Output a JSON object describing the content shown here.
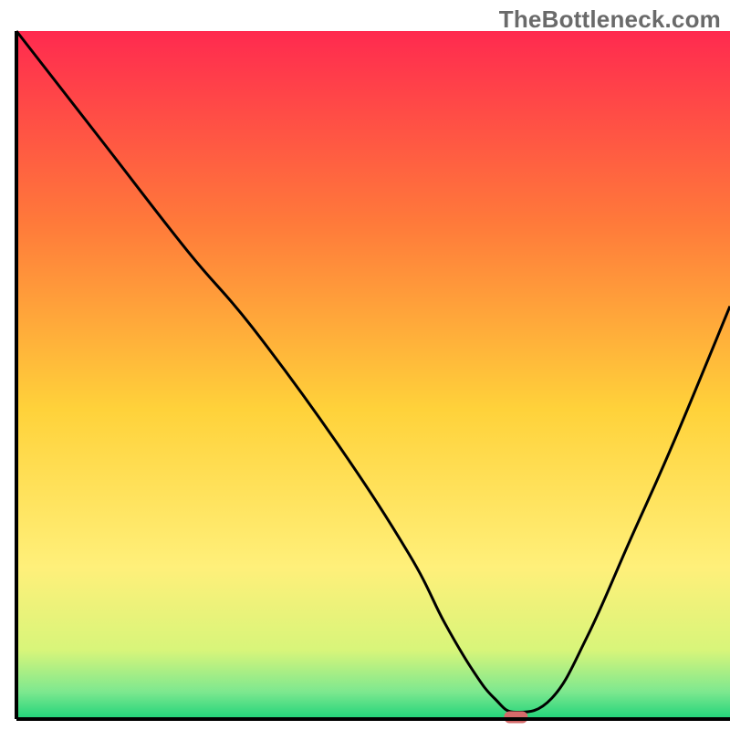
{
  "watermark": {
    "text": "TheBottleneck.com"
  },
  "chart_data": {
    "type": "line",
    "title": "",
    "xlabel": "",
    "ylabel": "",
    "xlim": [
      0,
      100
    ],
    "ylim": [
      0,
      100
    ],
    "series": [
      {
        "name": "bottleneck-curve",
        "x": [
          0,
          12,
          24,
          33,
          45,
          55,
          60,
          64,
          67,
          70,
          75,
          80,
          86,
          92,
          100
        ],
        "y": [
          100,
          84,
          68,
          57,
          40,
          24,
          14,
          7,
          3,
          1,
          3,
          12,
          26,
          40,
          60
        ]
      }
    ],
    "marker": {
      "name": "optimal-point",
      "x": 70,
      "y": 0,
      "color": "#d46a6a"
    },
    "background_gradient": {
      "stops": [
        {
          "offset": 0.0,
          "color": "#ff2a4f"
        },
        {
          "offset": 0.28,
          "color": "#ff7a3a"
        },
        {
          "offset": 0.55,
          "color": "#ffd23a"
        },
        {
          "offset": 0.78,
          "color": "#fff07a"
        },
        {
          "offset": 0.9,
          "color": "#d8f57a"
        },
        {
          "offset": 0.96,
          "color": "#7ee88f"
        },
        {
          "offset": 1.0,
          "color": "#1fd37a"
        }
      ]
    },
    "colors": {
      "axis": "#000000",
      "curve": "#000000"
    }
  }
}
